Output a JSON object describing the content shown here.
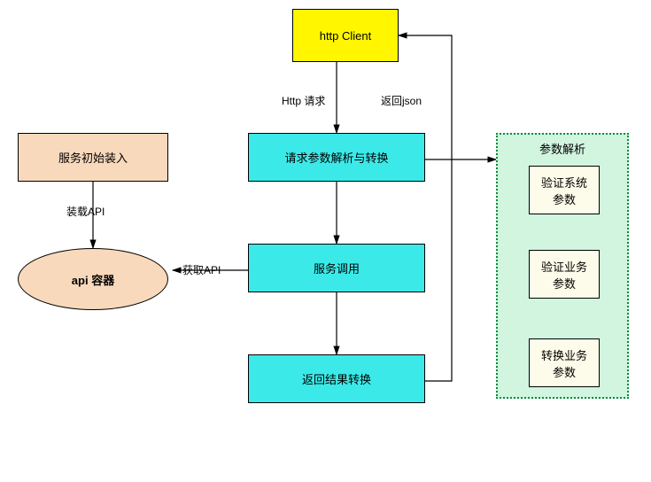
{
  "nodes": {
    "httpClient": "http Client",
    "reqParse": "请求参数解析与转换",
    "serviceCall": "服务调用",
    "resultConv": "返回结果转换",
    "serviceInit": "服务初始装入",
    "apiContainer": "api 容器",
    "group": {
      "title": "参数解析",
      "verifySys": "验证系统\n参数",
      "verifyBiz": "验证业务\n参数",
      "convertBiz": "转换业务\n参数"
    }
  },
  "edges": {
    "httpRequest": "Http 请求",
    "returnJson": "返回json",
    "loadApi": "装载API",
    "getApi": "获取API"
  }
}
